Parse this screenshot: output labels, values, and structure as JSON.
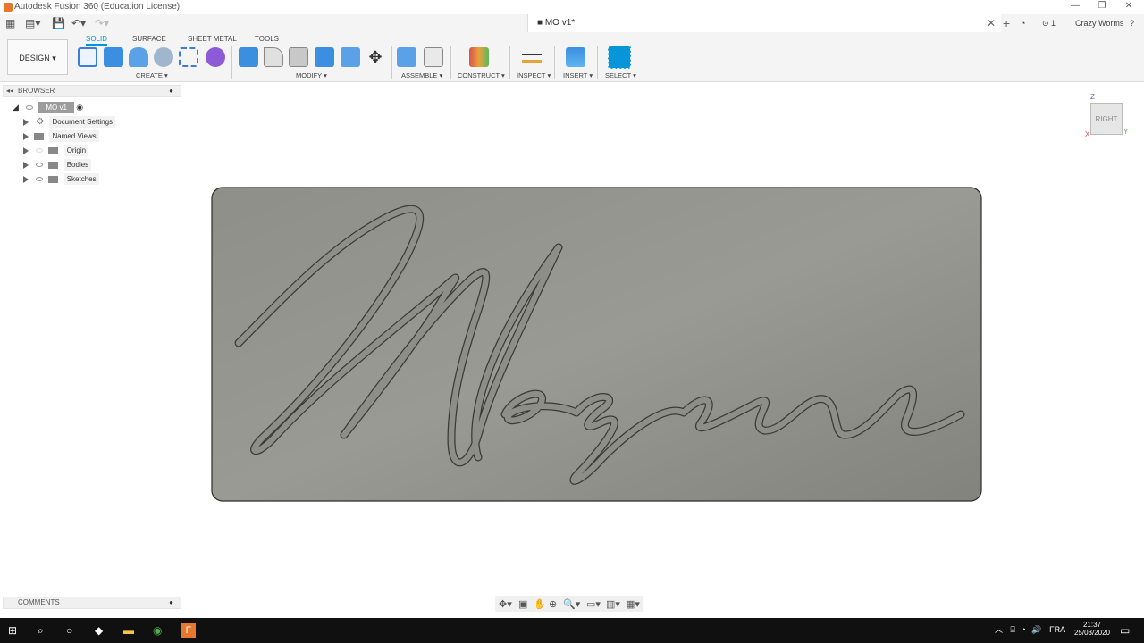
{
  "window": {
    "title": "Autodesk Fusion 360 (Education License)"
  },
  "doc_tab": {
    "title": "MO v1*"
  },
  "right_bar": {
    "notifications": "1",
    "user": "Crazy Worms"
  },
  "ribbon": {
    "workspace": "DESIGN",
    "tabs": [
      "SOLID",
      "SURFACE",
      "SHEET METAL",
      "TOOLS"
    ],
    "active_tab": "SOLID",
    "groups": [
      "CREATE",
      "MODIFY",
      "ASSEMBLE",
      "CONSTRUCT",
      "INSPECT",
      "INSERT",
      "SELECT"
    ]
  },
  "browser": {
    "header": "BROWSER",
    "root": "MO v1",
    "items": [
      "Document Settings",
      "Named Views",
      "Origin",
      "Bodies",
      "Sketches"
    ]
  },
  "viewcube": {
    "face": "RIGHT",
    "axis_z": "Z",
    "axis_y": "Y",
    "axis_x": "X"
  },
  "comments": {
    "header": "COMMENTS"
  },
  "taskbar": {
    "lang": "FRA",
    "time": "21:37",
    "date": "25/03/2020"
  },
  "colors": {
    "accent": "#0696d7",
    "plate": "#8a8a83",
    "taskbar": "#101010"
  }
}
